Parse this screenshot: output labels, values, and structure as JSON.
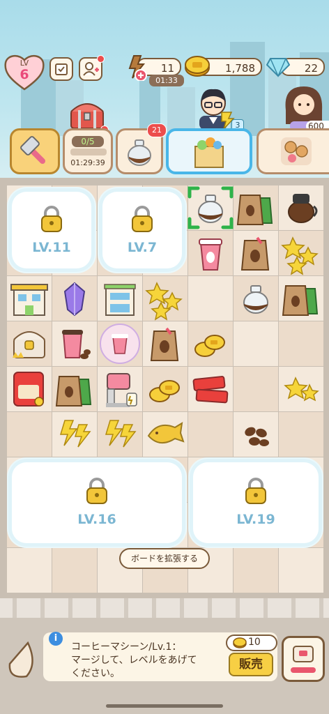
{
  "player": {
    "level_label": "LV",
    "level": "6"
  },
  "currencies": {
    "energy": "11",
    "energy_timer": "01:33",
    "coins": "1,788",
    "gems": "22"
  },
  "characters": {
    "count_badge": "3",
    "partial_counter": "600"
  },
  "tabs": {
    "chest_progress": "0/5",
    "chest_timer": "01:29:39",
    "pot_badge": "21"
  },
  "locked_areas": [
    {
      "label": "LV.11"
    },
    {
      "label": "LV.7"
    },
    {
      "label": "LV.16"
    },
    {
      "label": "LV.19"
    }
  ],
  "board_items": [
    {
      "name": "glass-coffee-pot",
      "row": 0,
      "col": 4,
      "selected": true
    },
    {
      "name": "coffee-bean-bag-green",
      "row": 0,
      "col": 5
    },
    {
      "name": "glass-coffee-pot-full",
      "row": 0,
      "col": 6
    },
    {
      "name": "paper-coffee-cup",
      "row": 1,
      "col": 4
    },
    {
      "name": "coffee-bean-bag",
      "row": 1,
      "col": 5
    },
    {
      "name": "gold-stars-pile",
      "row": 1,
      "col": 6
    },
    {
      "name": "cafe-shop-building",
      "row": 2,
      "col": 0
    },
    {
      "name": "purple-gem",
      "row": 2,
      "col": 1
    },
    {
      "name": "small-cafe-building",
      "row": 2,
      "col": 2
    },
    {
      "name": "gold-stars-pile",
      "row": 2,
      "col": 3
    },
    {
      "name": "glass-coffee-pot",
      "row": 2,
      "col": 5
    },
    {
      "name": "coffee-bean-bag-green",
      "row": 2,
      "col": 6
    },
    {
      "name": "locked-chest",
      "row": 3,
      "col": 0
    },
    {
      "name": "coffee-cup-with-beans",
      "row": 3,
      "col": 1
    },
    {
      "name": "bubble-coffee-cup",
      "row": 3,
      "col": 2
    },
    {
      "name": "coffee-bean-bag",
      "row": 3,
      "col": 3
    },
    {
      "name": "gold-coins",
      "row": 3,
      "col": 4
    },
    {
      "name": "snack-bag-red",
      "row": 4,
      "col": 0
    },
    {
      "name": "coffee-bean-bag-green",
      "row": 4,
      "col": 1
    },
    {
      "name": "coffee-machine",
      "row": 4,
      "col": 2
    },
    {
      "name": "gold-coins",
      "row": 4,
      "col": 3
    },
    {
      "name": "red-candy-packs",
      "row": 4,
      "col": 4
    },
    {
      "name": "gold-stars",
      "row": 4,
      "col": 6
    },
    {
      "name": "energy-bolts",
      "row": 5,
      "col": 1
    },
    {
      "name": "energy-bolts",
      "row": 5,
      "col": 2
    },
    {
      "name": "taiyaki-fish-cake",
      "row": 5,
      "col": 3
    },
    {
      "name": "coffee-beans",
      "row": 5,
      "col": 5
    }
  ],
  "expand_button": "ボードを拡張する",
  "info": {
    "line1": "コーヒーマシーン/Lv.1：",
    "line2": "マージして、レベルをあげて",
    "line3": "ください。",
    "sell_price": "10",
    "sell_label": "販売"
  },
  "colors": {
    "accent_gold": "#f2c63a",
    "brown_outline": "#7a5a3a",
    "select_green": "#2fb34a",
    "tab_highlight": "#49b6e8",
    "board_bg_light": "#f4e9dc",
    "board_bg_dark": "#ecdccb"
  }
}
